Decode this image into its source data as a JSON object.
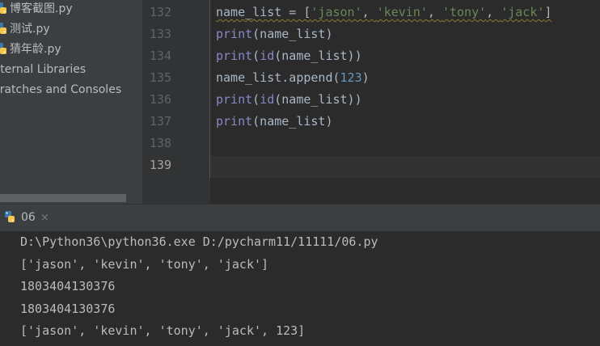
{
  "project_tree": {
    "files": [
      {
        "name": "博客截图.py",
        "icon": "python-file-icon"
      },
      {
        "name": "测试.py",
        "icon": "python-file-icon"
      },
      {
        "name": "猜年龄.py",
        "icon": "python-file-icon"
      }
    ],
    "external_libraries": "xternal Libraries",
    "scratches": "cratches and Consoles"
  },
  "editor": {
    "line_numbers": [
      "132",
      "133",
      "134",
      "135",
      "136",
      "137",
      "138",
      "139"
    ],
    "current_line": "139",
    "lines": [
      [
        {
          "t": "name_list = [",
          "c": "id"
        },
        {
          "t": "'jason'",
          "c": "str"
        },
        {
          "t": ", ",
          "c": "id"
        },
        {
          "t": "'kevin'",
          "c": "str"
        },
        {
          "t": ", ",
          "c": "id"
        },
        {
          "t": "'tony'",
          "c": "str"
        },
        {
          "t": ", ",
          "c": "id"
        },
        {
          "t": "'jack'",
          "c": "str"
        },
        {
          "t": "]",
          "c": "id"
        }
      ],
      [
        {
          "t": "print",
          "c": "kw"
        },
        {
          "t": "(name_list)",
          "c": "id"
        }
      ],
      [
        {
          "t": "print",
          "c": "kw"
        },
        {
          "t": "(",
          "c": "id"
        },
        {
          "t": "id",
          "c": "kw"
        },
        {
          "t": "(name_list))",
          "c": "id"
        }
      ],
      [
        {
          "t": "name_list.append(",
          "c": "id"
        },
        {
          "t": "123",
          "c": "num"
        },
        {
          "t": ")",
          "c": "id"
        }
      ],
      [
        {
          "t": "print",
          "c": "kw"
        },
        {
          "t": "(",
          "c": "id"
        },
        {
          "t": "id",
          "c": "kw"
        },
        {
          "t": "(name_list))",
          "c": "id"
        }
      ],
      [
        {
          "t": "print",
          "c": "kw"
        },
        {
          "t": "(name_list)",
          "c": "id"
        }
      ],
      [],
      []
    ]
  },
  "run_panel": {
    "tab_label": "06",
    "close_glyph": "×",
    "output": [
      "D:\\Python36\\python36.exe D:/pycharm11/11111/06.py",
      "['jason', 'kevin', 'tony', 'jack']",
      "1803404130376",
      "1803404130376",
      "['jason', 'kevin', 'tony', 'jack', 123]"
    ]
  },
  "colors": {
    "keyword": "#8888c6",
    "string": "#6a8759",
    "number": "#6897bb",
    "identifier": "#a9b7c6"
  }
}
